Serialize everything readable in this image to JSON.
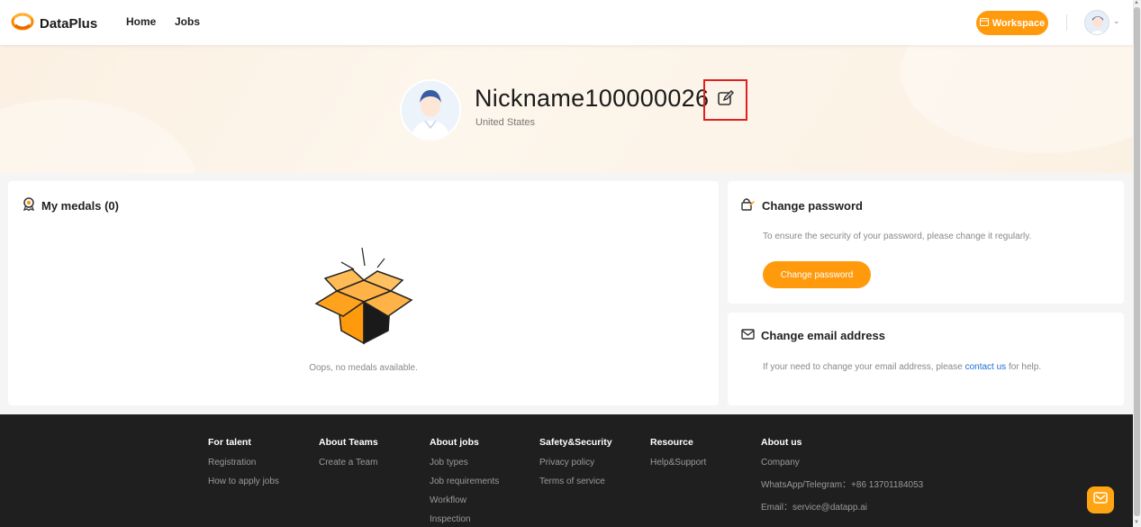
{
  "header": {
    "logo_text": "DataPlus",
    "nav": [
      {
        "label": "Home"
      },
      {
        "label": "Jobs"
      }
    ],
    "workspace_label": "Workspace"
  },
  "profile": {
    "nickname": "Nickname100000026",
    "country": "United States"
  },
  "medals": {
    "title": "My medals (0)",
    "empty_text": "Oops, no medals available."
  },
  "password": {
    "title": "Change password",
    "description": "To ensure the security of your password, please change it regularly.",
    "button_label": "Change password"
  },
  "email": {
    "title": "Change email address",
    "text_before": "If your need to change your email address, please",
    "link_text": "contact us",
    "text_after": "for help."
  },
  "footer": {
    "columns": [
      {
        "heading": "For talent",
        "items": [
          "Registration",
          "How to apply jobs"
        ]
      },
      {
        "heading": "About Teams",
        "items": [
          "Create a Team"
        ]
      },
      {
        "heading": "About jobs",
        "items": [
          "Job types",
          "Job requirements",
          "Workflow",
          "Inspection"
        ]
      },
      {
        "heading": "Safety&Security",
        "items": [
          "Privacy policy",
          "Terms of service"
        ]
      },
      {
        "heading": "Resource",
        "items": [
          "Help&Support"
        ]
      },
      {
        "heading": "About us",
        "items": [
          "Company",
          "WhatsApp/Telegram：+86 13701184053",
          "Email：service@datapp.ai"
        ]
      }
    ]
  },
  "colors": {
    "accent": "#ff9a0c",
    "highlight_border": "#e02020",
    "link": "#1e6fd9",
    "footer_bg": "#1f1f1f"
  }
}
